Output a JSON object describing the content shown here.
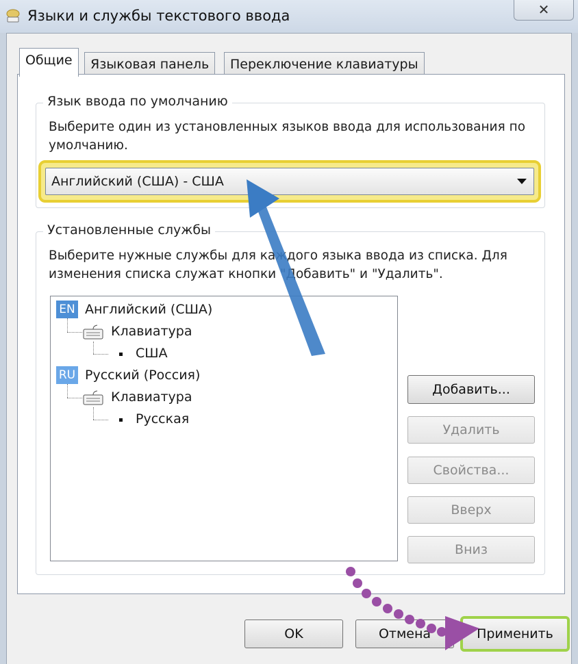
{
  "window": {
    "title": "Языки и службы текстового ввода",
    "close_glyph": "✕",
    "icon": "keyboard-globe-icon"
  },
  "tabs": [
    {
      "label": "Общие",
      "active": true
    },
    {
      "label": "Языковая панель",
      "active": false
    },
    {
      "label": "Переключение клавиатуры",
      "active": false
    }
  ],
  "default_language": {
    "group_title": "Язык ввода по умолчанию",
    "description": "Выберите один из установленных языков ввода для использования по умолчанию.",
    "selected_value": "Английский (США) - США",
    "highlight_color": "#e8cf34"
  },
  "installed_services": {
    "group_title": "Установленные службы",
    "description": "Выберите нужные службы для каждого языка ввода из списка. Для изменения списка служат кнопки \"Добавить\" и \"Удалить\".",
    "tree": [
      {
        "badge": "EN",
        "language": "Английский (США)",
        "category": "Клавиатура",
        "layout": "США"
      },
      {
        "badge": "RU",
        "language": "Русский (Россия)",
        "category": "Клавиатура",
        "layout": "Русская"
      }
    ],
    "buttons": {
      "add": "Добавить...",
      "remove": "Удалить",
      "properties": "Свойства...",
      "up": "Вверх",
      "down": "Вниз"
    }
  },
  "footer": {
    "ok": "OK",
    "cancel": "Отмена",
    "apply": "Применить",
    "apply_highlight_color": "#9fd24a"
  },
  "annotations": {
    "arrow_color": "#3b7cc4",
    "dotted_arrow_color": "#9a4fa5"
  }
}
